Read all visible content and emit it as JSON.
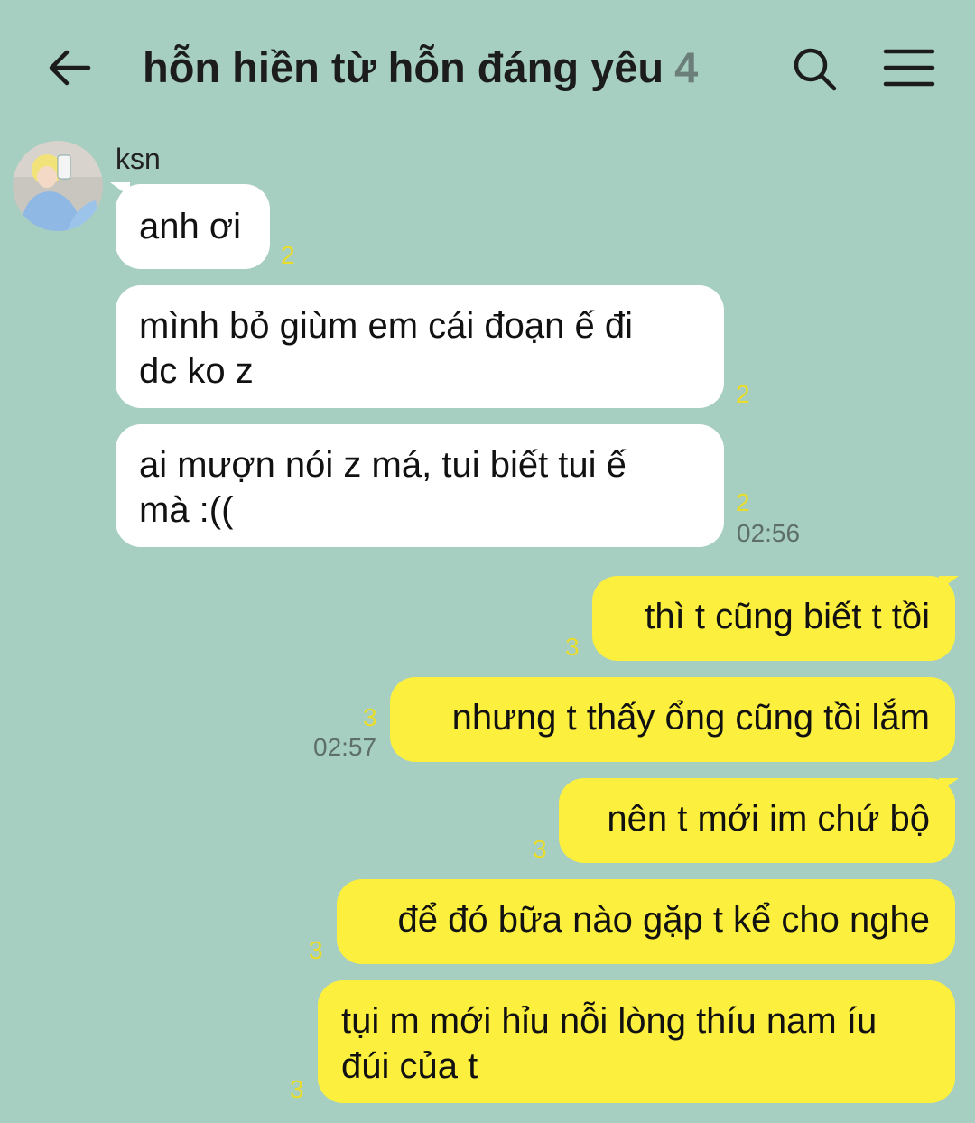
{
  "header": {
    "title": "hỗn hiền từ hỗn đáng yêu",
    "member_count": "4"
  },
  "messages": {
    "sender_name": "ksn",
    "m1": {
      "text": "anh ơi",
      "unread": "2"
    },
    "m2": {
      "line1": "mình bỏ giùm em cái đoạn ế đi",
      "line2": "dc ko z",
      "unread": "2"
    },
    "m3": {
      "line1": "ai mượn nói z má, tui biết tui ế",
      "line2": "mà :((",
      "unread": "2",
      "time": "02:56"
    },
    "m4": {
      "text": "thì t cũng biết t tồi",
      "unread": "3"
    },
    "m5": {
      "text": "nhưng t thấy ổng cũng tồi lắm",
      "unread": "3",
      "time": "02:57"
    },
    "m6": {
      "text": "nên t mới im chứ bộ",
      "unread": "3"
    },
    "m7": {
      "text": "để đó bữa nào gặp t kể cho nghe",
      "unread": "3"
    },
    "m8": {
      "line1": "tụi m mới hỉu nỗi lòng thíu nam íu",
      "line2": "đúi của t",
      "unread": "3"
    }
  },
  "colors": {
    "background": "#a6cfc1",
    "incoming_bubble": "#ffffff",
    "outgoing_bubble": "#fcef3e",
    "unread": "#e9dc2b"
  },
  "icons": [
    "back-arrow-icon",
    "search-icon",
    "menu-icon",
    "avatar"
  ]
}
